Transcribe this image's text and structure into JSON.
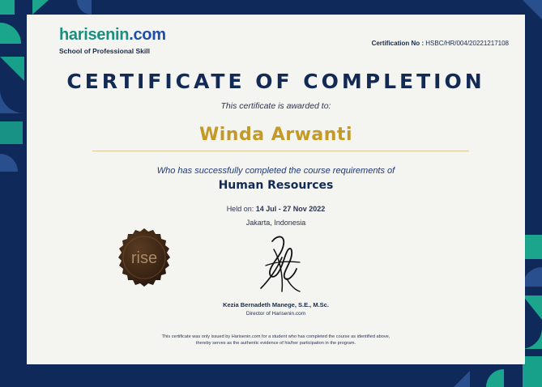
{
  "brand": {
    "logo_name": "harisenin",
    "logo_tld": ".com",
    "tagline": "School of Professional Skill",
    "seal_text": "rise"
  },
  "certificate": {
    "number_label": "Certification No :",
    "number_value": "HSBC/HR/004/20221217108",
    "title": "CERTIFICATE OF COMPLETION",
    "awarded_text": "This certificate is awarded to:",
    "recipient": "Winda Arwanti",
    "completion_text": "Who has successfully completed the course requirements of",
    "course": "Human Resources",
    "held_label": "Held on:",
    "held_dates": "14 Jul - 27 Nov 2022",
    "location": "Jakarta, Indonesia",
    "signer_name": "Kezia Bernadeth Manege, S.E., M.Sc.",
    "signer_role": "Director of Harisenin.com",
    "disclaimer_line1": "This certificate was only issued by Harisenin.com for a student who has completed the course as identified above,",
    "disclaimer_line2": "thereby serves as the authentic evidence of his/her participation in the program."
  },
  "colors": {
    "navy": "#0f2a5a",
    "teal": "#1aa58c",
    "gold": "#c49a27",
    "paper": "#f4f4f1"
  }
}
